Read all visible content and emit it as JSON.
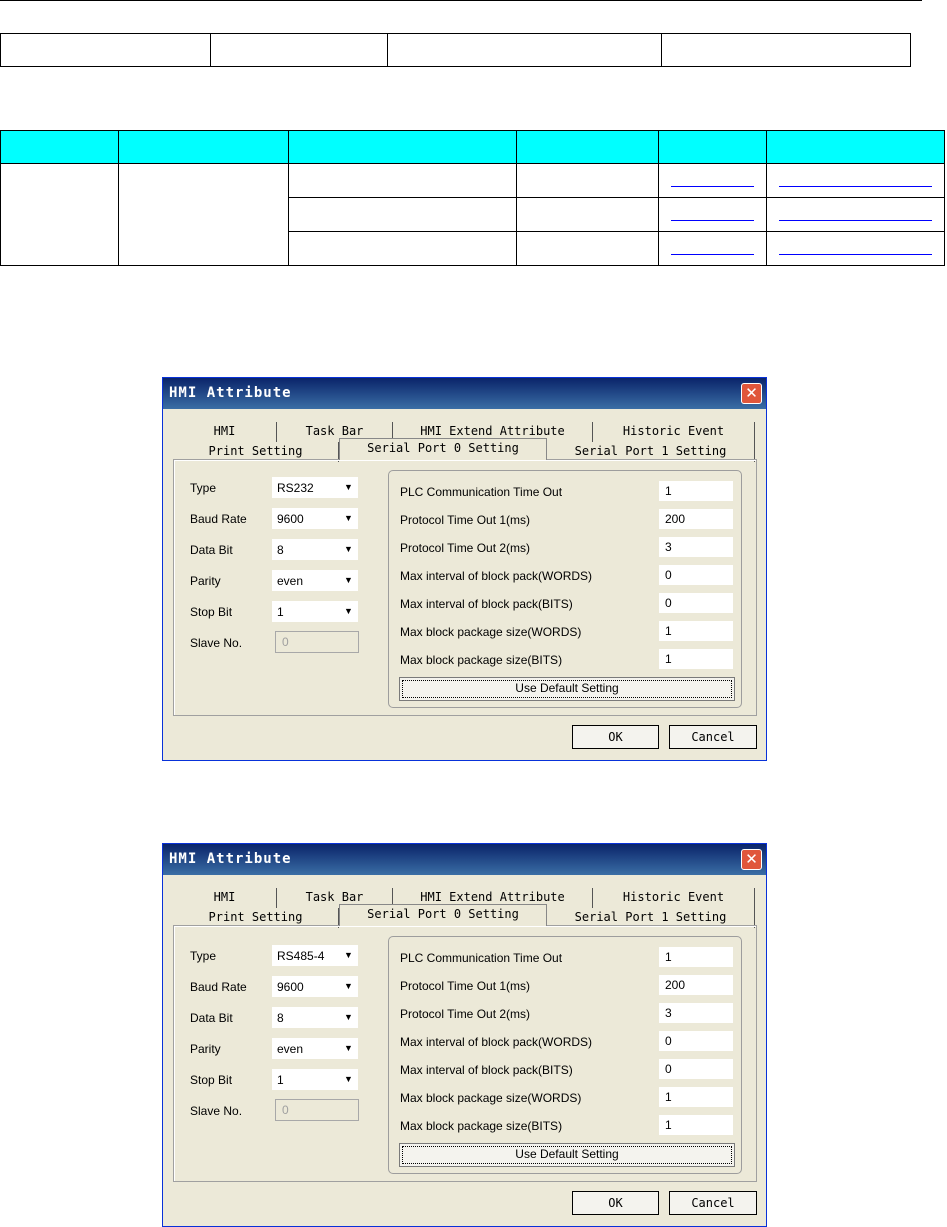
{
  "dialogs": [
    {
      "title": "HMI Attribute",
      "tabs_row1": [
        "HMI",
        "Task Bar",
        "HMI Extend Attribute",
        "Historic Event"
      ],
      "tabs_row2": [
        "Print Setting",
        "Serial Port 0 Setting",
        "Serial Port 1 Setting"
      ],
      "fields": {
        "type_label": "Type",
        "type_value": "RS232",
        "baud_label": "Baud Rate",
        "baud_value": "9600",
        "databit_label": "Data Bit",
        "databit_value": "8",
        "parity_label": "Parity",
        "parity_value": "even",
        "stopbit_label": "Stop Bit",
        "stopbit_value": "1",
        "slave_label": "Slave No.",
        "slave_value": "0"
      },
      "params": [
        {
          "label": "PLC Communication Time Out",
          "value": "1"
        },
        {
          "label": "Protocol Time Out 1(ms)",
          "value": "200"
        },
        {
          "label": "Protocol Time Out 2(ms)",
          "value": "3"
        },
        {
          "label": "Max interval of block pack(WORDS)",
          "value": "0"
        },
        {
          "label": "Max interval of block pack(BITS)",
          "value": "0"
        },
        {
          "label": "Max block package size(WORDS)",
          "value": "1"
        },
        {
          "label": "Max block package size(BITS)",
          "value": "1"
        }
      ],
      "default_button": "Use Default Setting",
      "ok_button": "OK",
      "cancel_button": "Cancel"
    },
    {
      "title": "HMI Attribute",
      "tabs_row1": [
        "HMI",
        "Task Bar",
        "HMI Extend Attribute",
        "Historic Event"
      ],
      "tabs_row2": [
        "Print Setting",
        "Serial Port 0 Setting",
        "Serial Port 1 Setting"
      ],
      "fields": {
        "type_label": "Type",
        "type_value": "RS485-4",
        "baud_label": "Baud Rate",
        "baud_value": "9600",
        "databit_label": "Data Bit",
        "databit_value": "8",
        "parity_label": "Parity",
        "parity_value": "even",
        "stopbit_label": "Stop Bit",
        "stopbit_value": "1",
        "slave_label": "Slave No.",
        "slave_value": "0"
      },
      "params": [
        {
          "label": "PLC Communication Time Out",
          "value": "1"
        },
        {
          "label": "Protocol Time Out 1(ms)",
          "value": "200"
        },
        {
          "label": "Protocol Time Out 2(ms)",
          "value": "3"
        },
        {
          "label": "Max interval of block pack(WORDS)",
          "value": "0"
        },
        {
          "label": "Max interval of block pack(BITS)",
          "value": "0"
        },
        {
          "label": "Max block package size(WORDS)",
          "value": "1"
        },
        {
          "label": "Max block package size(BITS)",
          "value": "1"
        }
      ],
      "default_button": "Use Default Setting",
      "ok_button": "OK",
      "cancel_button": "Cancel"
    }
  ],
  "icons": {
    "close": "close-icon",
    "dropdown": "chevron-down-icon"
  },
  "colors": {
    "table_header": "#00ffff",
    "link": "#0000ff",
    "titlebar": "#0a246a"
  }
}
